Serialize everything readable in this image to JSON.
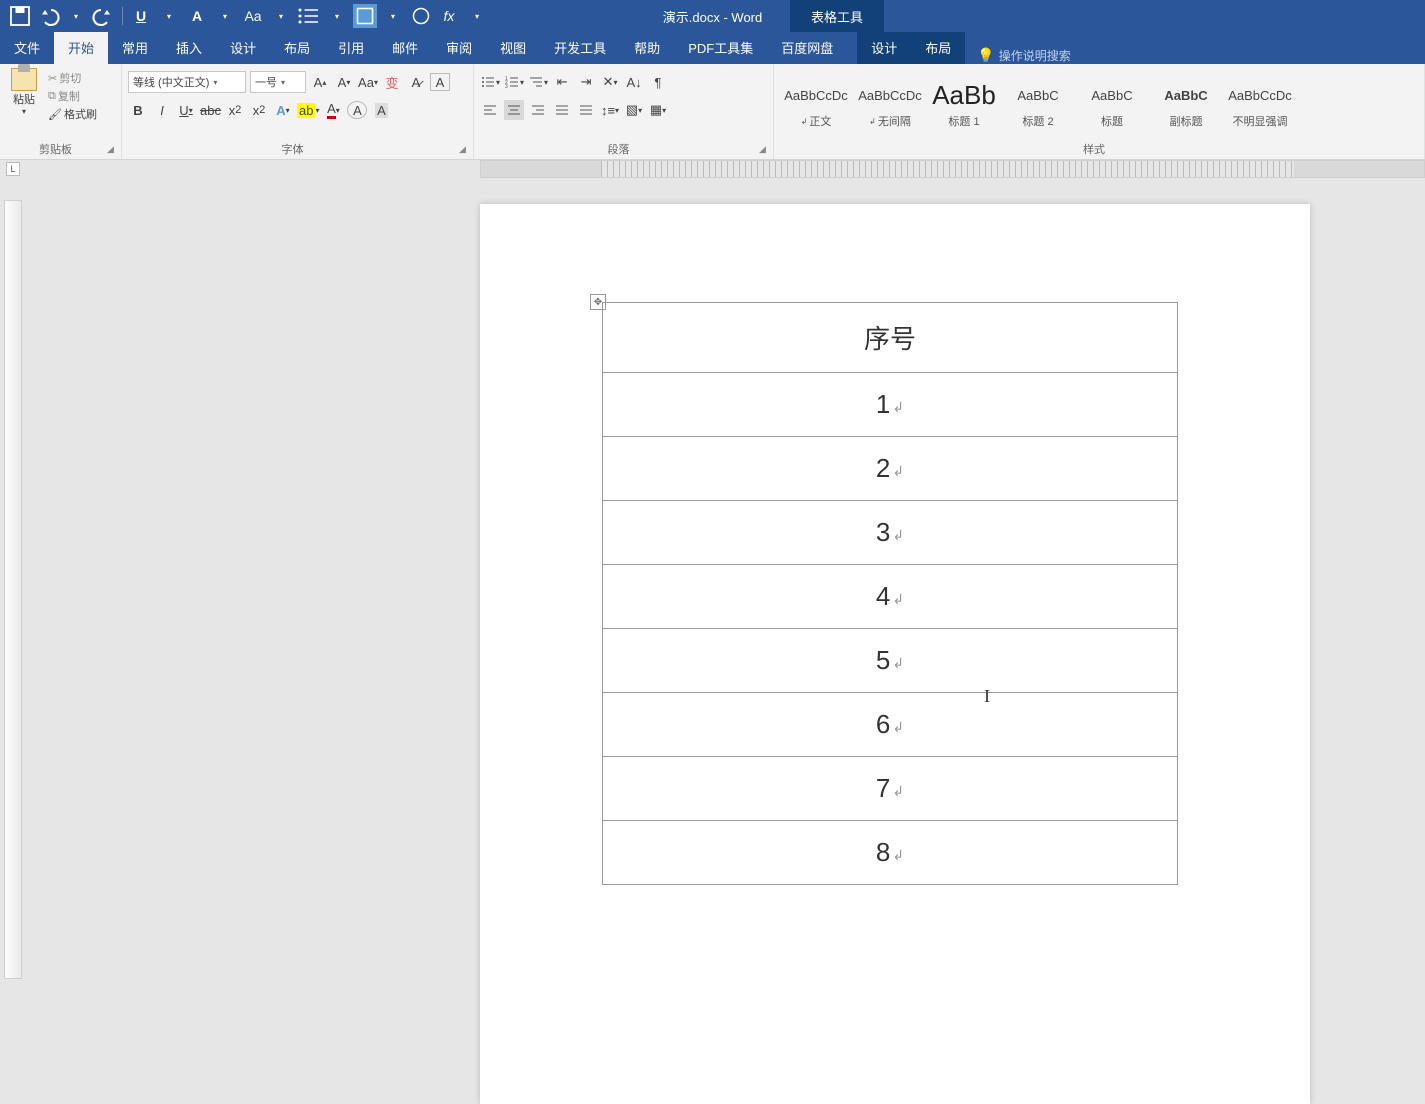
{
  "app": {
    "title_doc": "演示.docx",
    "title_sep": " - ",
    "title_app": "Word",
    "context_tool": "表格工具"
  },
  "qat": {
    "save_icon": "save-icon",
    "undo_icon": "undo-icon",
    "redo_icon": "redo-icon",
    "fx_label": "fx"
  },
  "tabs": {
    "file": "文件",
    "home": "开始",
    "common": "常用",
    "insert": "插入",
    "design": "设计",
    "layout": "布局",
    "references": "引用",
    "mail": "邮件",
    "review": "审阅",
    "view": "视图",
    "developer": "开发工具",
    "help": "帮助",
    "pdf": "PDF工具集",
    "baidu": "百度网盘",
    "ctx_design": "设计",
    "ctx_layout": "布局",
    "tell_me": "操作说明搜索"
  },
  "ribbon": {
    "clipboard": {
      "paste": "粘贴",
      "cut": "剪切",
      "copy": "复制",
      "format_painter": "格式刷",
      "group_label": "剪贴板"
    },
    "font": {
      "font_name": "等线 (中文正文)",
      "font_size": "一号",
      "group_label": "字体"
    },
    "paragraph": {
      "group_label": "段落"
    },
    "styles": {
      "group_label": "样式",
      "items": [
        {
          "preview": "AaBbCcDc",
          "name": "正文",
          "mark": true,
          "cls": ""
        },
        {
          "preview": "AaBbCcDc",
          "name": "无间隔",
          "mark": true,
          "cls": ""
        },
        {
          "preview": "AaBb",
          "name": "标题 1",
          "mark": false,
          "cls": "big"
        },
        {
          "preview": "AaBbC",
          "name": "标题 2",
          "mark": false,
          "cls": ""
        },
        {
          "preview": "AaBbC",
          "name": "标题",
          "mark": false,
          "cls": ""
        },
        {
          "preview": "AaBbC",
          "name": "副标题",
          "mark": false,
          "cls": "bold"
        },
        {
          "preview": "AaBbCcDc",
          "name": "不明显强调",
          "mark": false,
          "cls": ""
        }
      ]
    }
  },
  "document": {
    "table_header": "序号",
    "rows": [
      "1",
      "2",
      "3",
      "4",
      "5",
      "6",
      "7",
      "8"
    ]
  }
}
